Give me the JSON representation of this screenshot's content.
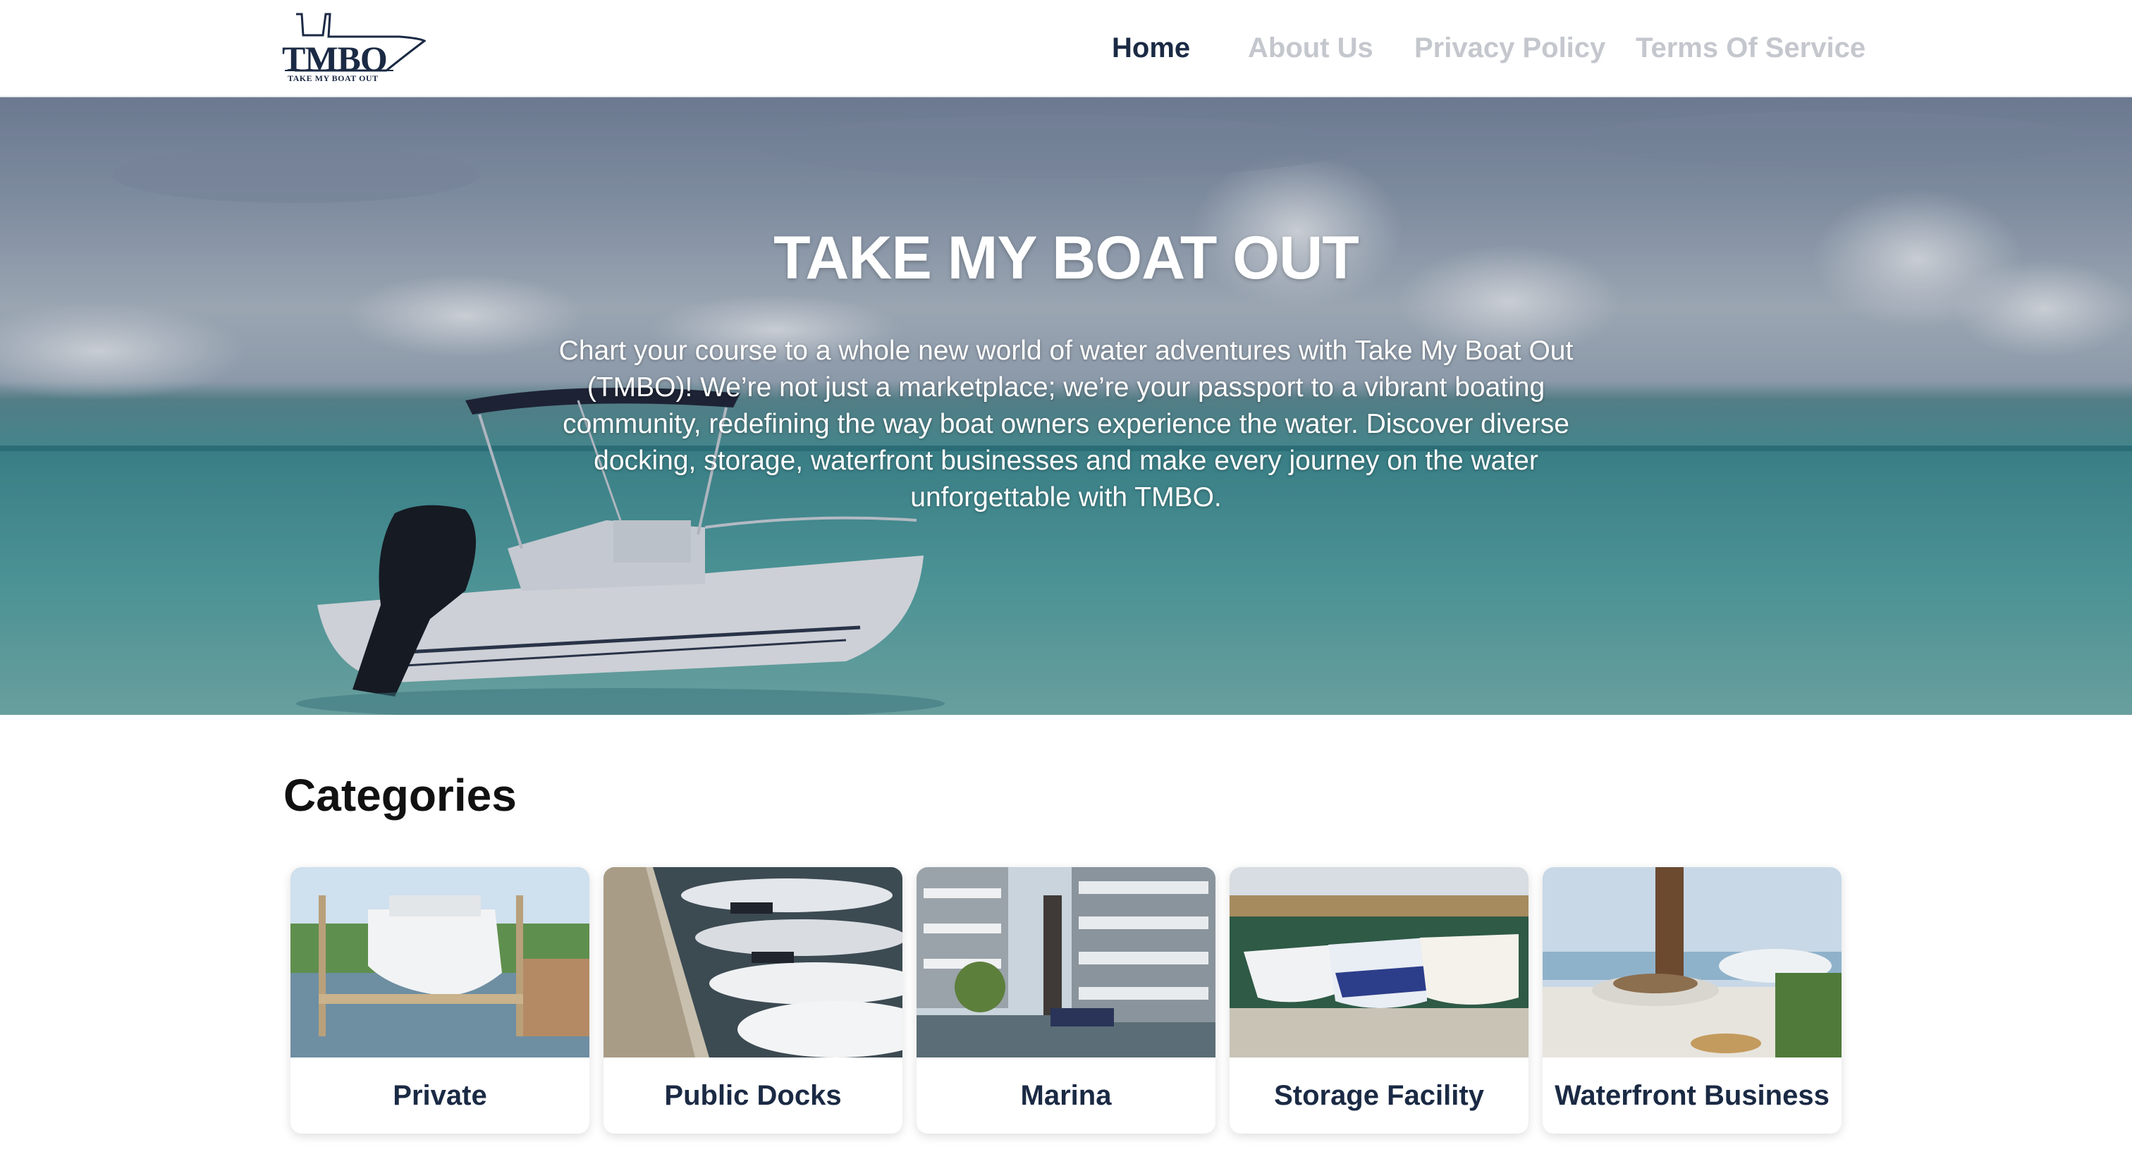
{
  "brand": {
    "logo_text": "TMBO",
    "logo_tagline": "TAKE MY BOAT OUT"
  },
  "nav": {
    "items": [
      {
        "label": "Home",
        "active": true
      },
      {
        "label": "About Us",
        "active": false
      },
      {
        "label": "Privacy Policy",
        "active": false
      },
      {
        "label": "Terms Of Service",
        "active": false
      }
    ]
  },
  "hero": {
    "title": "TAKE MY BOAT OUT",
    "description": "Chart your course to a whole new world of water adventures with Take My Boat Out (TMBO)! We’re not just a marketplace; we’re your passport to a vibrant boating community, redefining the way boat owners experience the water. Discover diverse docking, storage, waterfront businesses and make every journey on the water unforgettable with TMBO.",
    "image": "boat-on-turquoise-water"
  },
  "categories": {
    "heading": "Categories",
    "items": [
      {
        "label": "Private",
        "image": "boat-lift-private-dock"
      },
      {
        "label": "Public Docks",
        "image": "boats-at-public-dock"
      },
      {
        "label": "Marina",
        "image": "marina-dry-stack-racks"
      },
      {
        "label": "Storage Facility",
        "image": "boats-in-storage-yard"
      },
      {
        "label": "Waterfront Business",
        "image": "waterfront-restaurant-table"
      }
    ]
  },
  "colors": {
    "navy": "#1b2a44",
    "nav_inactive": "#c4c7cd",
    "water": "#4b9b9b"
  }
}
